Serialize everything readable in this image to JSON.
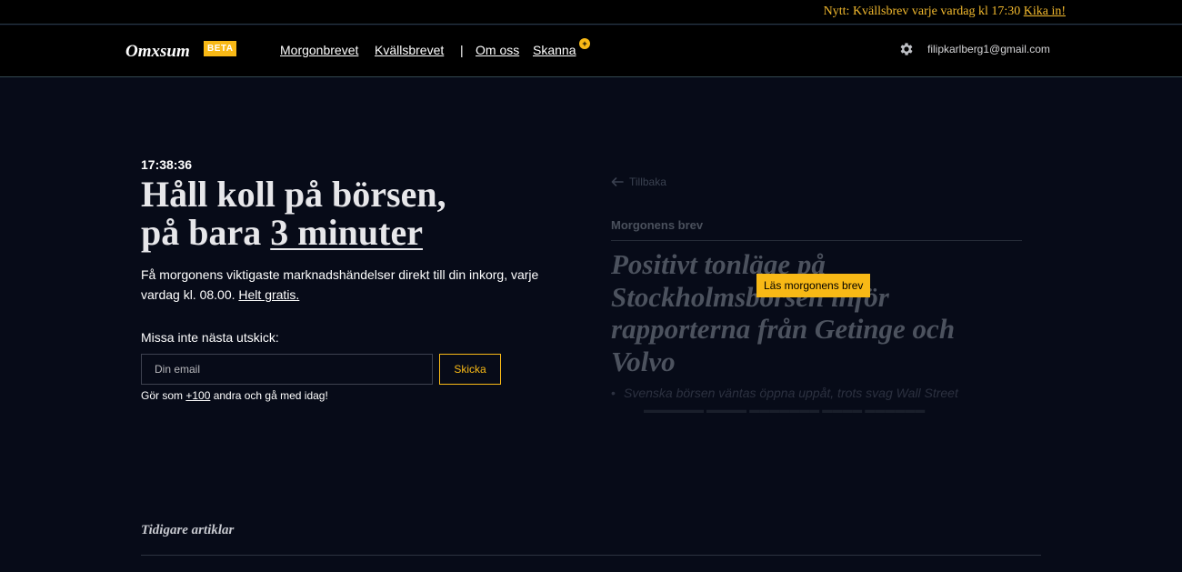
{
  "announcement": {
    "text": "Nytt: Kvällsbrev varje vardag kl 17:30",
    "link": "Kika in!"
  },
  "nav": {
    "logo": "Omxsum",
    "badge": "BETA",
    "links": [
      "Morgonbrevet",
      "Kvällsbrevet",
      "Om oss",
      "Skanna"
    ],
    "separator": "|",
    "skanna_badge": "+",
    "user_email": "filipkarlberg1@gmail.com"
  },
  "hero": {
    "clock": "17:38:36",
    "headline_line1": "Håll koll på börsen,",
    "headline_line2_prefix": "på bara ",
    "headline_line2_emphasis": "3 minuter",
    "lead_text": "Få morgonens viktigaste marknadshändelser direkt till din inkorg, varje vardag kl. 08.00. ",
    "lead_link": "Helt gratis."
  },
  "signup": {
    "label": "Missa inte nästa utskick:",
    "placeholder": "Din email",
    "submit": "Skicka",
    "social_prefix": "Gör som ",
    "social_count": "+100",
    "social_suffix": " andra och gå med idag!"
  },
  "preview": {
    "back": "Tillbaka",
    "section": "Morgonens brev",
    "title": "Positivt tonläge på Stockholmsbörsen inför rapporterna från Getinge och Volvo",
    "bullet": "Svenska börsen väntas öppna uppåt, trots svag Wall Street",
    "read_button": "Läs morgonens brev"
  },
  "previous": {
    "heading": "Tidigare artiklar"
  },
  "colors": {
    "background": "#070b18",
    "accent": "#f8b916",
    "bar": "#000000"
  }
}
